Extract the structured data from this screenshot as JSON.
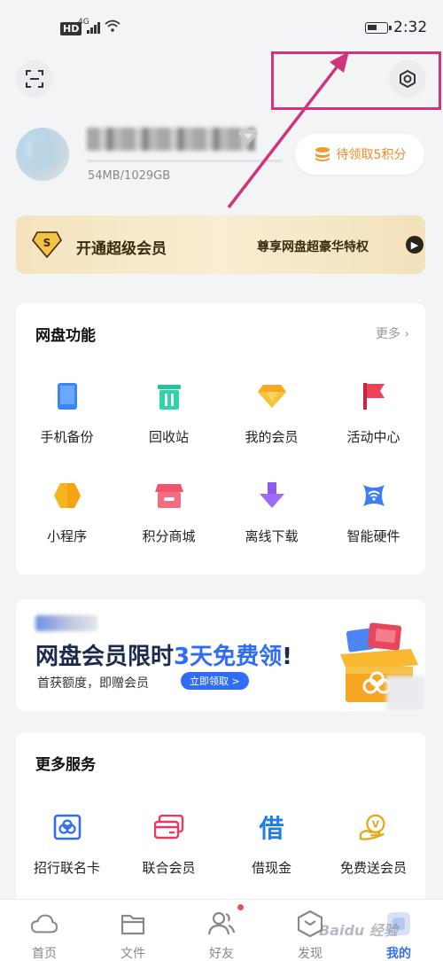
{
  "status_bar": {
    "hd": "HD",
    "network": "4G",
    "time": "2:32"
  },
  "profile": {
    "storage": "54MB/1029GB",
    "points_label": "待领取5积分"
  },
  "vip_banner": {
    "badge": "S",
    "title": "开通超级会员",
    "subtitle": "尊享网盘超豪华特权",
    "arrow": "▶"
  },
  "features": {
    "title": "网盘功能",
    "more": "更多 ›",
    "items": [
      {
        "label": "手机备份",
        "icon": "phone-icon"
      },
      {
        "label": "回收站",
        "icon": "trash-icon"
      },
      {
        "label": "我的会员",
        "icon": "gem-icon"
      },
      {
        "label": "活动中心",
        "icon": "flag-icon"
      },
      {
        "label": "小程序",
        "icon": "hexagon-icon"
      },
      {
        "label": "积分商城",
        "icon": "shop-icon"
      },
      {
        "label": "离线下载",
        "icon": "download-icon"
      },
      {
        "label": "智能硬件",
        "icon": "smart-device-icon"
      }
    ]
  },
  "promo": {
    "headline_pre": "网盘会员限时",
    "headline_highlight": "3天免费领",
    "headline_post": "!",
    "sub": "首获额度，即赠会员",
    "button": "立即领取 >"
  },
  "services": {
    "title": "更多服务",
    "items": [
      {
        "label": "招行联名卡",
        "icon": "bank-card-icon"
      },
      {
        "label": "联合会员",
        "icon": "card-icon"
      },
      {
        "label": "借现金",
        "icon": "borrow-icon",
        "glyph": "借"
      },
      {
        "label": "免费送会员",
        "icon": "gift-vip-icon",
        "glyph": "V"
      }
    ]
  },
  "bottom_nav": {
    "items": [
      {
        "label": "首页",
        "icon": "cloud-icon"
      },
      {
        "label": "文件",
        "icon": "folder-icon"
      },
      {
        "label": "好友",
        "icon": "friends-icon"
      },
      {
        "label": "发现",
        "icon": "discover-icon"
      },
      {
        "label": "我的",
        "icon": "me-icon",
        "active": true
      }
    ]
  },
  "watermark": "Baidu 经验",
  "colors": {
    "accent": "#2f6df6",
    "highlight_box": "#d0347a",
    "points": "#f08b24"
  }
}
